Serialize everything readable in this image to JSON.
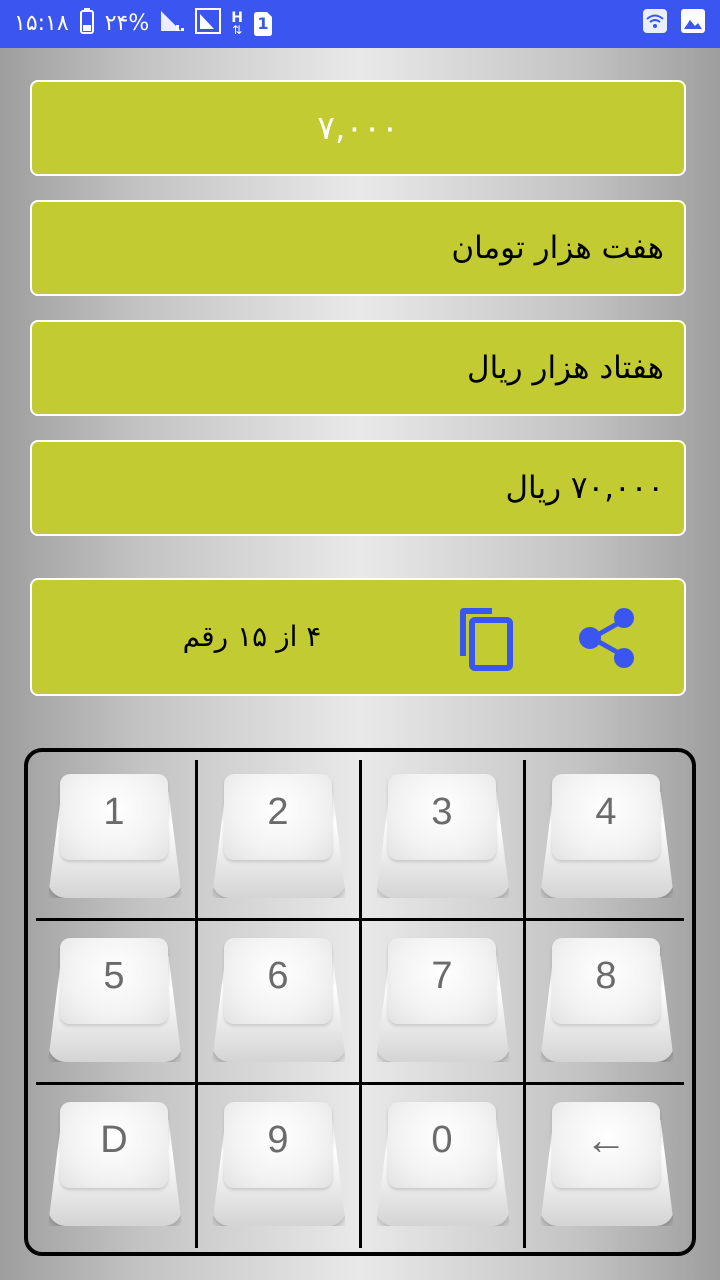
{
  "status_bar": {
    "time": "۱۵:۱۸",
    "battery_percent": "۲۴%",
    "network_type": "H",
    "sim_slot": "1"
  },
  "display": {
    "amount_digits": "۷,۰۰۰",
    "toman_words": "هفت هزار  تومان",
    "rial_words": "هفتاد هزار  ریال",
    "rial_digits": "۷۰,۰۰۰ ریال"
  },
  "actions": {
    "digit_count": "۴ از ۱۵ رقم",
    "copy_icon": "copy-icon",
    "share_icon": "share-icon"
  },
  "keypad": {
    "keys": [
      {
        "label": "1"
      },
      {
        "label": "2"
      },
      {
        "label": "3"
      },
      {
        "label": "4"
      },
      {
        "label": "5"
      },
      {
        "label": "6"
      },
      {
        "label": "7"
      },
      {
        "label": "8"
      },
      {
        "label": "D"
      },
      {
        "label": "9"
      },
      {
        "label": "0"
      },
      {
        "label": "←"
      }
    ]
  },
  "colors": {
    "status_bar": "#3a55f0",
    "field_bg": "#c2cb31",
    "icon_accent": "#3a55f0"
  }
}
